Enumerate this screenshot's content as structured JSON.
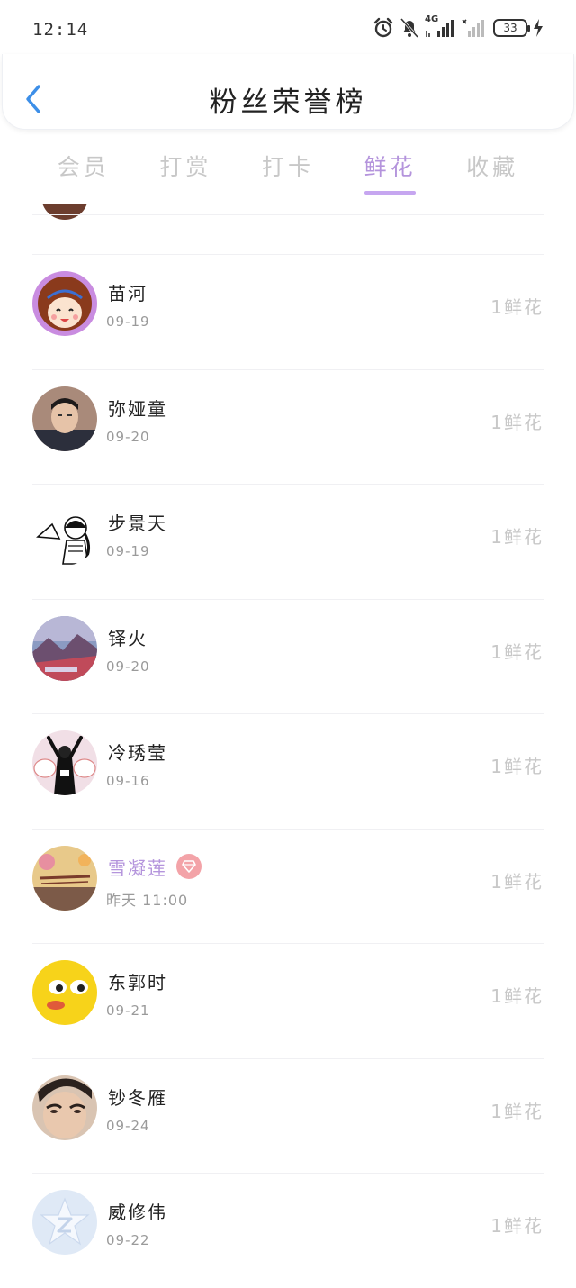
{
  "status": {
    "time": "12:14",
    "network": "4G",
    "battery": "33"
  },
  "header": {
    "title": "粉丝荣誉榜"
  },
  "tabs": [
    {
      "label": "会员",
      "active": false
    },
    {
      "label": "打赏",
      "active": false
    },
    {
      "label": "打卡",
      "active": false
    },
    {
      "label": "鲜花",
      "active": true
    },
    {
      "label": "收藏",
      "active": false
    }
  ],
  "fans": [
    {
      "name": "苗河",
      "date": "09-19",
      "count": "1鲜花",
      "avatar": "cartoon-girl-avatar"
    },
    {
      "name": "弥娅童",
      "date": "09-20",
      "count": "1鲜花",
      "avatar": "boy-photo-avatar"
    },
    {
      "name": "步景天",
      "date": "09-19",
      "count": "1鲜花",
      "avatar": "manga-sketch-avatar"
    },
    {
      "name": "铎火",
      "date": "09-20",
      "count": "1鲜花",
      "avatar": "sunset-photo-avatar"
    },
    {
      "name": "冷琇莹",
      "date": "09-16",
      "count": "1鲜花",
      "avatar": "hello-kitty-avatar"
    },
    {
      "name": "雪凝莲",
      "date": "昨天 11:00",
      "count": "1鲜花",
      "avatar": "floral-card-avatar",
      "vip": true
    },
    {
      "name": "东郭时",
      "date": "09-21",
      "count": "1鲜花",
      "avatar": "yellow-emoji-avatar"
    },
    {
      "name": "钞冬雁",
      "date": "09-24",
      "count": "1鲜花",
      "avatar": "person-photo-avatar"
    },
    {
      "name": "威修伟",
      "date": "09-22",
      "count": "1鲜花",
      "avatar": "qzone-star-avatar"
    }
  ],
  "colors": {
    "accent": "#b494dc",
    "indicator": "#c6a6f0",
    "back": "#3d8fe8",
    "inactive_tab": "#c8c8c8",
    "vip_badge": "#f3a3a8"
  }
}
